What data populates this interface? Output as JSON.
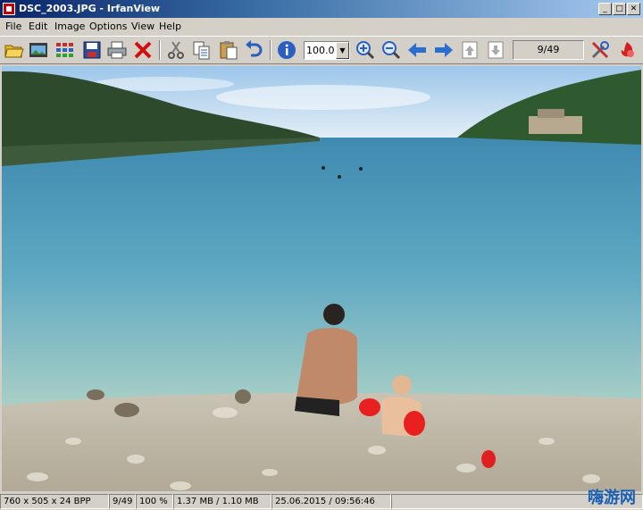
{
  "window": {
    "title": "DSC_2003.JPG - IrfanView"
  },
  "menu": [
    "File",
    "Edit",
    "Image",
    "Options",
    "View",
    "Help"
  ],
  "toolbar": {
    "zoom_value": "100.0",
    "page_counter": "9/49",
    "buttons": [
      "open-folder-icon",
      "slideshow-icon",
      "thumbnails-icon",
      "save-icon",
      "print-icon",
      "delete-icon",
      "cut-icon",
      "copy-icon",
      "paste-icon",
      "undo-icon",
      "info-icon",
      "zoom-in-icon",
      "zoom-out-icon",
      "previous-icon",
      "next-icon",
      "first-page-icon",
      "last-page-icon",
      "settings-icon",
      "exit-icon"
    ]
  },
  "statusbar": {
    "dimensions": "760 x 505 x 24 BPP",
    "index": "9/49",
    "zoom": "100 %",
    "filesize": "1.37 MB / 1.10 MB",
    "datetime": "25.06.2015 / 09:56:46"
  },
  "watermark": "嗨游网",
  "colors": {
    "title_start": "#0a246a",
    "title_end": "#a6caf0",
    "chrome": "#d4d0c8"
  }
}
